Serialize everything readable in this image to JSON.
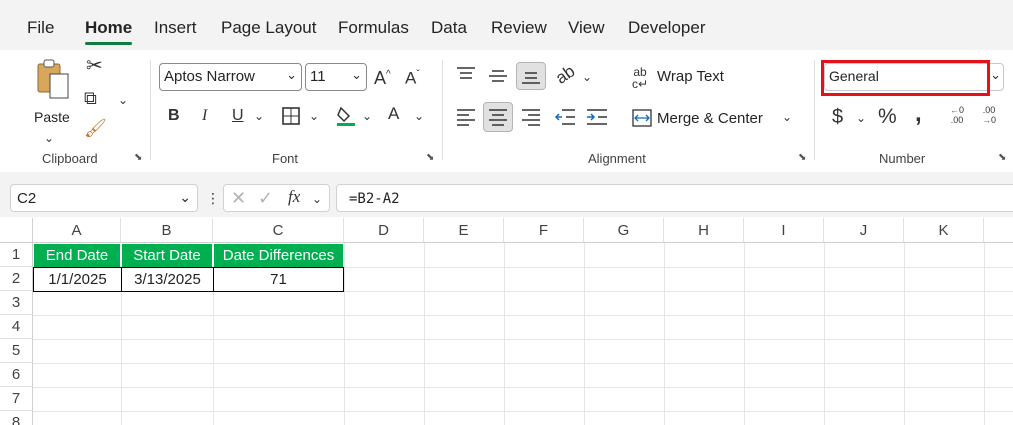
{
  "tabs": [
    "File",
    "Home",
    "Insert",
    "Page Layout",
    "Formulas",
    "Data",
    "Review",
    "View",
    "Developer"
  ],
  "active_tab": "Home",
  "ribbon": {
    "clipboard": {
      "paste_label": "Paste",
      "group_label": "Clipboard"
    },
    "font": {
      "font_name": "Aptos Narrow",
      "font_size": "11",
      "group_label": "Font",
      "bold": "B",
      "italic": "I",
      "underline": "U",
      "font_color_glyph": "A",
      "grow_glyph": "A",
      "shrink_glyph": "A"
    },
    "alignment": {
      "wrap_text_label": "Wrap Text",
      "merge_center_label": "Merge & Center",
      "group_label": "Alignment"
    },
    "number": {
      "format": "General",
      "group_label": "Number",
      "currency": "$",
      "percent": "%",
      "comma": ",",
      "inc_dec": ".00",
      "dec_dec": ".00"
    }
  },
  "formula_bar": {
    "name_box": "C2",
    "fx": "fx",
    "formula": "=B2-A2"
  },
  "sheet": {
    "columns": [
      "A",
      "B",
      "C",
      "D",
      "E",
      "F",
      "G",
      "H",
      "I",
      "J",
      "K"
    ],
    "rows": [
      "1",
      "2",
      "3",
      "4",
      "5",
      "6",
      "7",
      "8"
    ],
    "headers": [
      "End Date",
      "Start Date",
      "Date Differences"
    ],
    "values": [
      "1/1/2025",
      "3/13/2025",
      "71"
    ]
  },
  "colors": {
    "header_fill": "#00b050",
    "accent": "#107c41",
    "highlight": "#e3121b"
  }
}
